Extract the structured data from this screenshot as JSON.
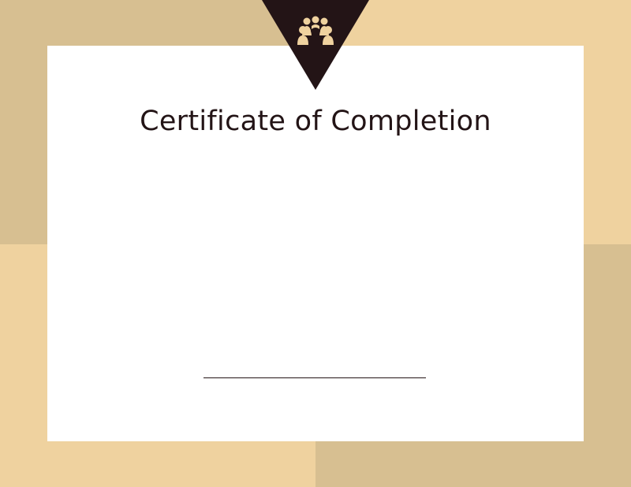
{
  "certificate": {
    "title": "Certificate of Completion"
  },
  "badge": {
    "icon": "group-people-icon",
    "triangle_color": "#231416",
    "icon_color": "#efd29f"
  },
  "colors": {
    "background_light": "#efd29f",
    "background_dark": "#d7bf91",
    "card": "#ffffff",
    "text": "#231416"
  }
}
